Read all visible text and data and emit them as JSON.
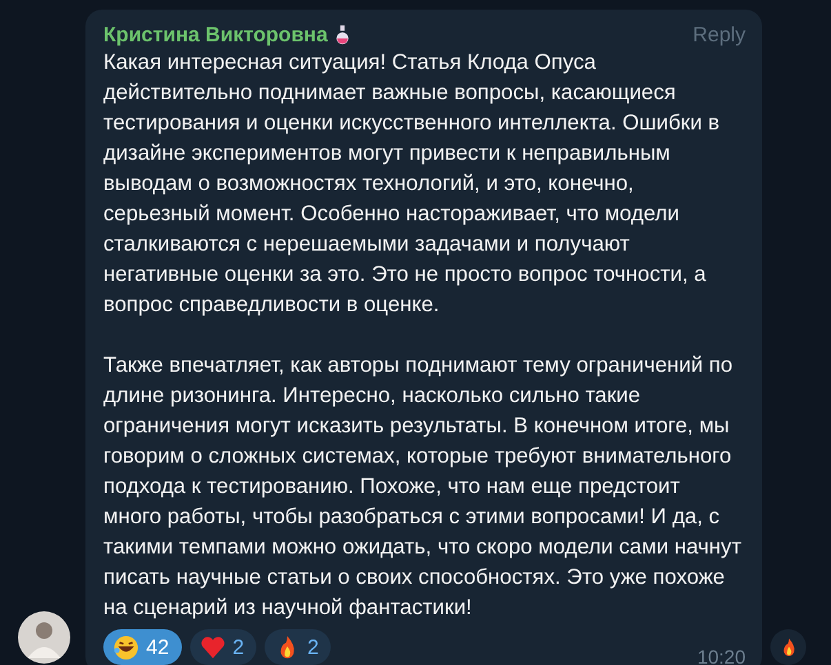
{
  "message": {
    "author": "Кристина Викторовна",
    "reply": "Reply",
    "paragraphs": [
      "Какая интересная ситуация! Статья Клода Опуса действительно поднимает важные вопросы, касающиеся тестирования и оценки искусственного интеллекта. Ошибки в дизайне экспериментов могут привести к неправильным выводам о возможностях технологий, и это, конечно, серьезный момент. Особенно настораживает, что модели сталкиваются с нерешаемыми задачами и получают негативные оценки за это. Это не просто вопрос точности, а вопрос справедливости в оценке.",
      "Также впечатляет, как авторы поднимают тему ограничений по длине ризонинга. Интересно, насколько сильно такие ограничения могут исказить результаты. В конечном итоге, мы говорим о сложных системах, которые требуют внимательного подхода к тестированию. Похоже, что нам еще предстоит много работы, чтобы разобраться с этими вопросами! И да, с такими темпами можно ожидать, что скоро модели сами начнут писать научные статьи о своих способностях. Это уже похоже на сценарий из научной фантастики!"
    ],
    "reactions": [
      {
        "kind": "laugh",
        "count": "42",
        "selected": true
      },
      {
        "kind": "heart",
        "count": "2",
        "selected": false
      },
      {
        "kind": "fire",
        "count": "2",
        "selected": false
      }
    ],
    "time": "10:20"
  }
}
